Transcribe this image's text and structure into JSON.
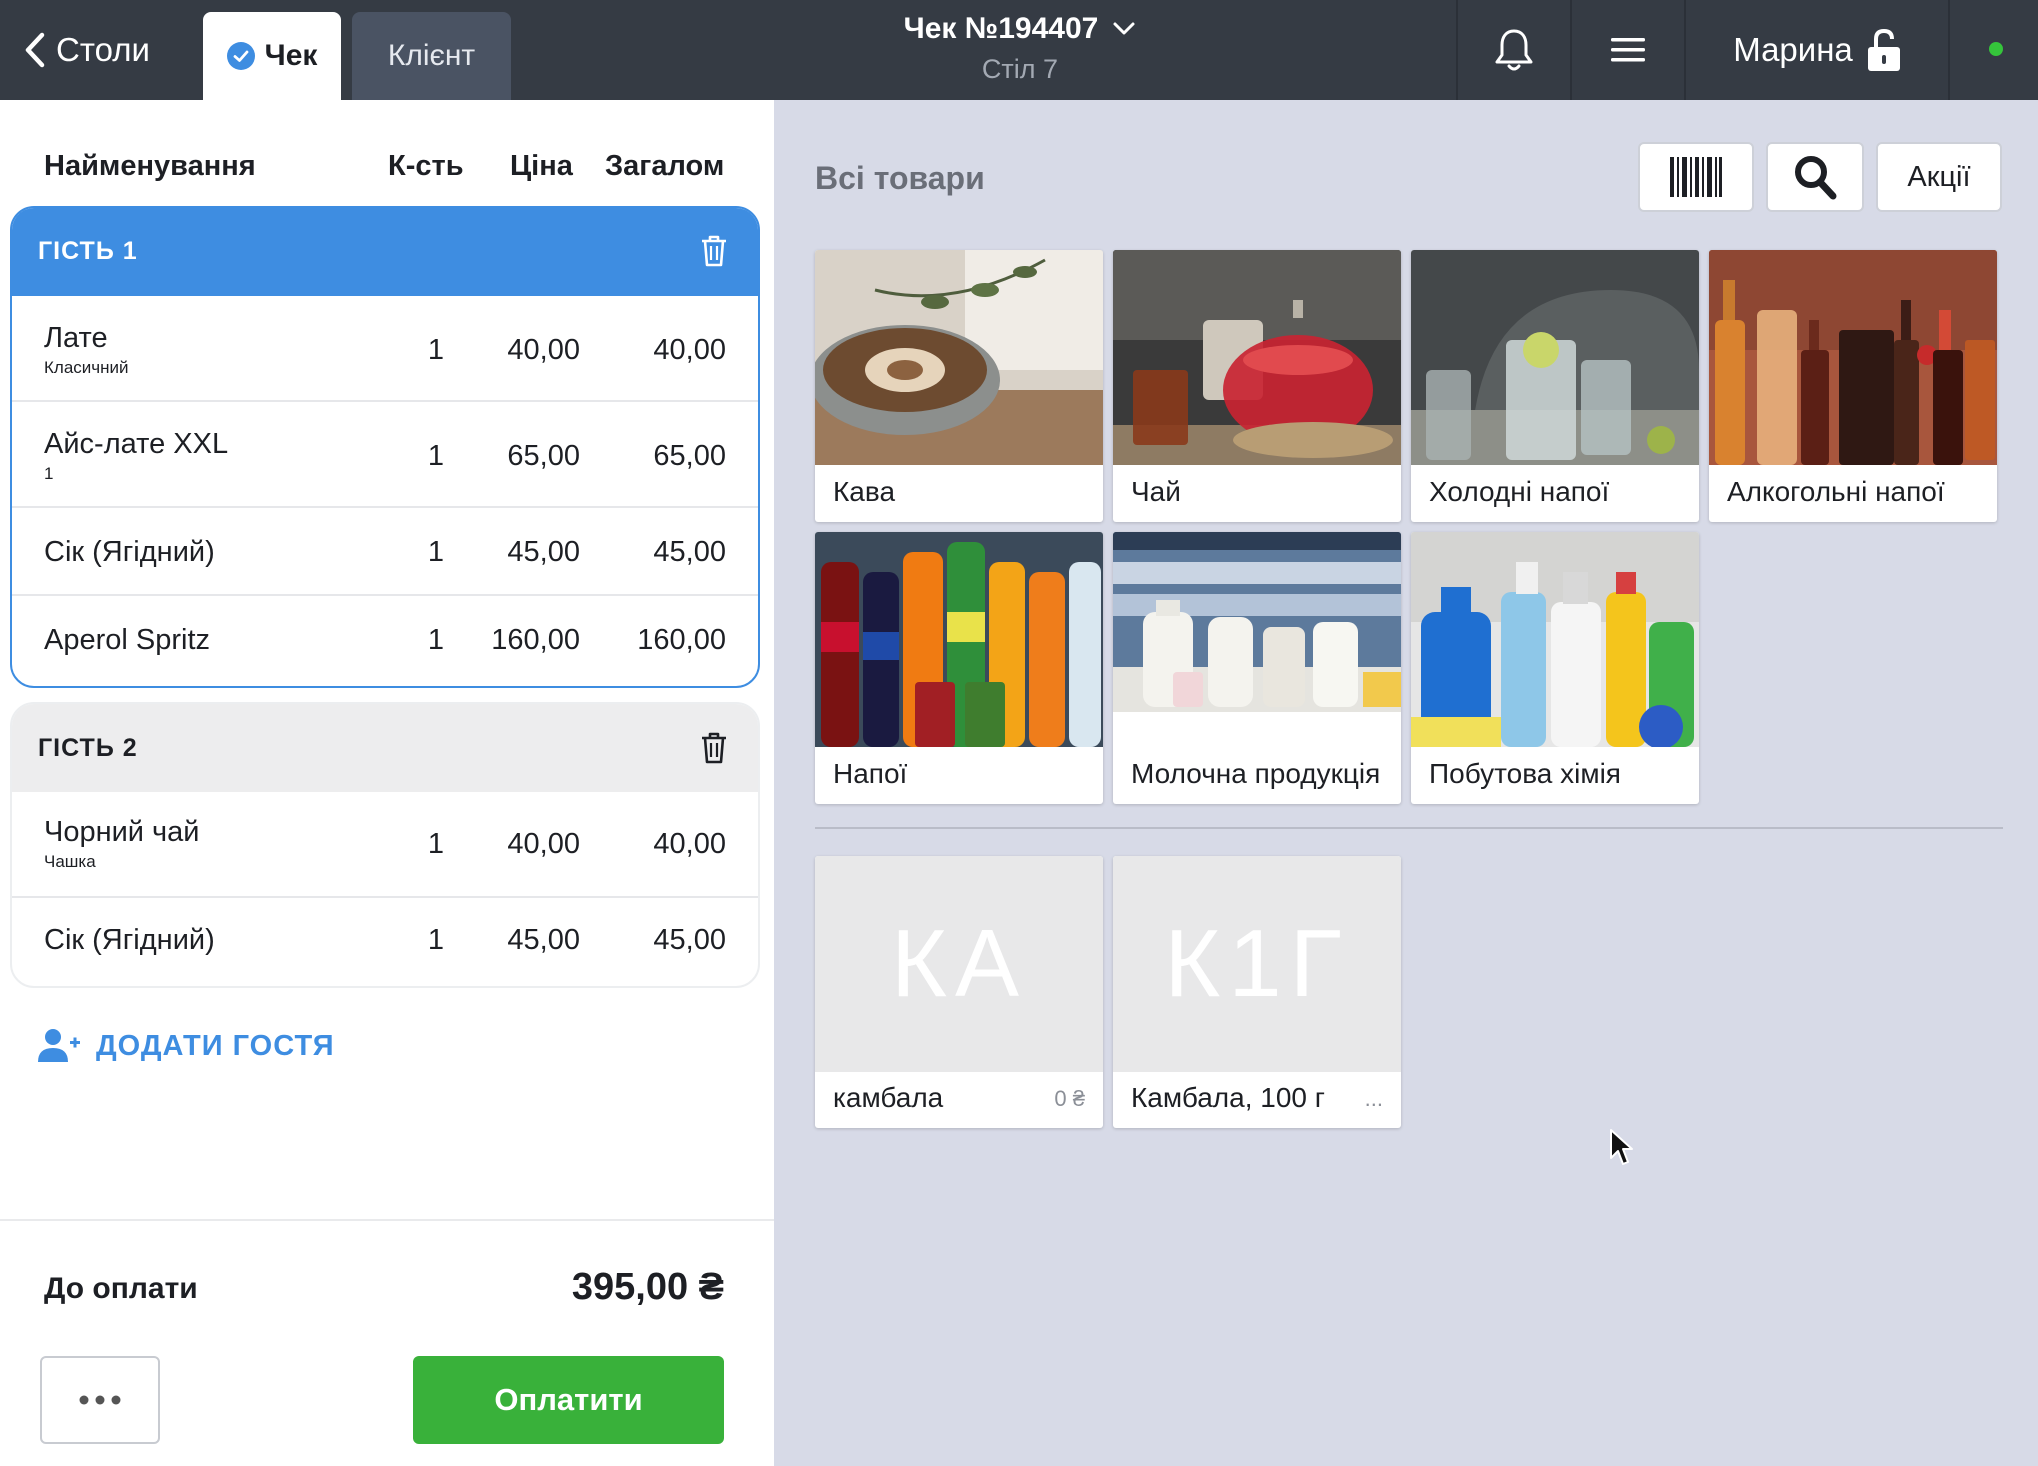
{
  "header": {
    "back_label": "Столи",
    "tabs": [
      {
        "label": "Чек",
        "active": true
      },
      {
        "label": "Клієнт",
        "active": false
      }
    ],
    "title": "Чек №194407",
    "subtitle": "Стіл 7",
    "user_name": "Марина",
    "status_color": "#35c53b"
  },
  "order": {
    "columns": [
      "Найменування",
      "К-сть",
      "Ціна",
      "Загалом"
    ],
    "guests": [
      {
        "label": "ГІСТЬ 1",
        "items": [
          {
            "name": "Лате",
            "modifier": "Класичний",
            "qty": "1",
            "price": "40,00",
            "total": "40,00"
          },
          {
            "name": "Айс-лате XXL",
            "modifier": "1",
            "qty": "1",
            "price": "65,00",
            "total": "65,00"
          },
          {
            "name": "Сік (Ягідний)",
            "modifier": "",
            "qty": "1",
            "price": "45,00",
            "total": "45,00"
          },
          {
            "name": "Aperol Spritz",
            "modifier": "",
            "qty": "1",
            "price": "160,00",
            "total": "160,00"
          }
        ]
      },
      {
        "label": "ГІСТЬ 2",
        "items": [
          {
            "name": "Чорний чай",
            "modifier": "Чашка",
            "qty": "1",
            "price": "40,00",
            "total": "40,00"
          },
          {
            "name": "Сік (Ягідний)",
            "modifier": "",
            "qty": "1",
            "price": "45,00",
            "total": "45,00"
          }
        ]
      }
    ],
    "add_guest_label": "ДОДАТИ ГОСТЯ",
    "to_pay_label": "До оплати",
    "to_pay_amount": "395,00 ₴",
    "pay_button": "Оплатити"
  },
  "catalog": {
    "title": "Всі товари",
    "promo_button": "Акції",
    "categories": [
      {
        "name": "Кава"
      },
      {
        "name": "Чай"
      },
      {
        "name": "Холодні напої"
      },
      {
        "name": "Алкогольні напої"
      },
      {
        "name": "Напої"
      },
      {
        "name": "Молочна продукція"
      },
      {
        "name": "Побутова хімія"
      }
    ],
    "products": [
      {
        "initials": "КА",
        "name": "камбала",
        "price": "0 ₴"
      },
      {
        "initials": "К1Г",
        "name": "Камбала, 100 г",
        "price": "..."
      }
    ]
  },
  "colors": {
    "accent": "#3e8de1",
    "pay": "#39b13a",
    "topbar": "#353b44",
    "panel_bg": "#d7dae7"
  }
}
